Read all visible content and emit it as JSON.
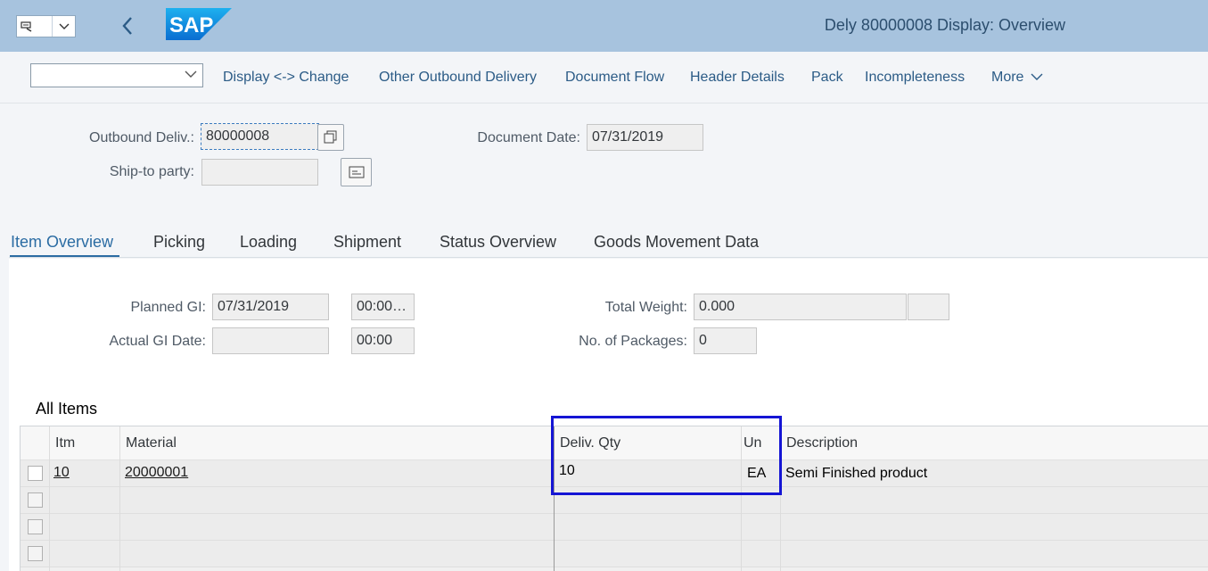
{
  "shell": {
    "title": "Dely 80000008 Display: Overview",
    "logo_text": "SAP",
    "menu_icon": "menu-icon",
    "back_icon": "back-icon"
  },
  "toolbar": {
    "select_value": "",
    "items": [
      "Display <-> Change",
      "Other Outbound Delivery",
      "Document Flow",
      "Header Details",
      "Pack",
      "Incompleteness",
      "More"
    ]
  },
  "header": {
    "outbound_label": "Outbound Deliv.:",
    "outbound_value": "80000008",
    "shipto_label": "Ship-to party:",
    "shipto_value": "",
    "docdate_label": "Document Date:",
    "docdate_value": "07/31/2019"
  },
  "tabs": [
    "Item Overview",
    "Picking",
    "Loading",
    "Shipment",
    "Status Overview",
    "Goods Movement Data"
  ],
  "overview": {
    "planned_gi_label": "Planned GI:",
    "planned_gi_date": "07/31/2019",
    "planned_gi_time": "00:00…",
    "actual_gi_label": "Actual GI Date:",
    "actual_gi_date": "",
    "actual_gi_time": "00:00",
    "total_weight_label": "Total Weight:",
    "total_weight_value": "0.000",
    "total_weight_unit": "",
    "packages_label": "No. of Packages:",
    "packages_value": "0"
  },
  "items": {
    "title": "All Items",
    "columns": [
      "Itm",
      "Material",
      "Deliv. Qty",
      "Un",
      "Description"
    ],
    "rows": [
      {
        "itm": "10",
        "material": "20000001",
        "qty": "10",
        "un": "EA",
        "description": "Semi Finished product"
      }
    ]
  },
  "colors": {
    "shell_bg": "#a7c3de",
    "link": "#2b5b86",
    "highlight": "#1515d4"
  }
}
